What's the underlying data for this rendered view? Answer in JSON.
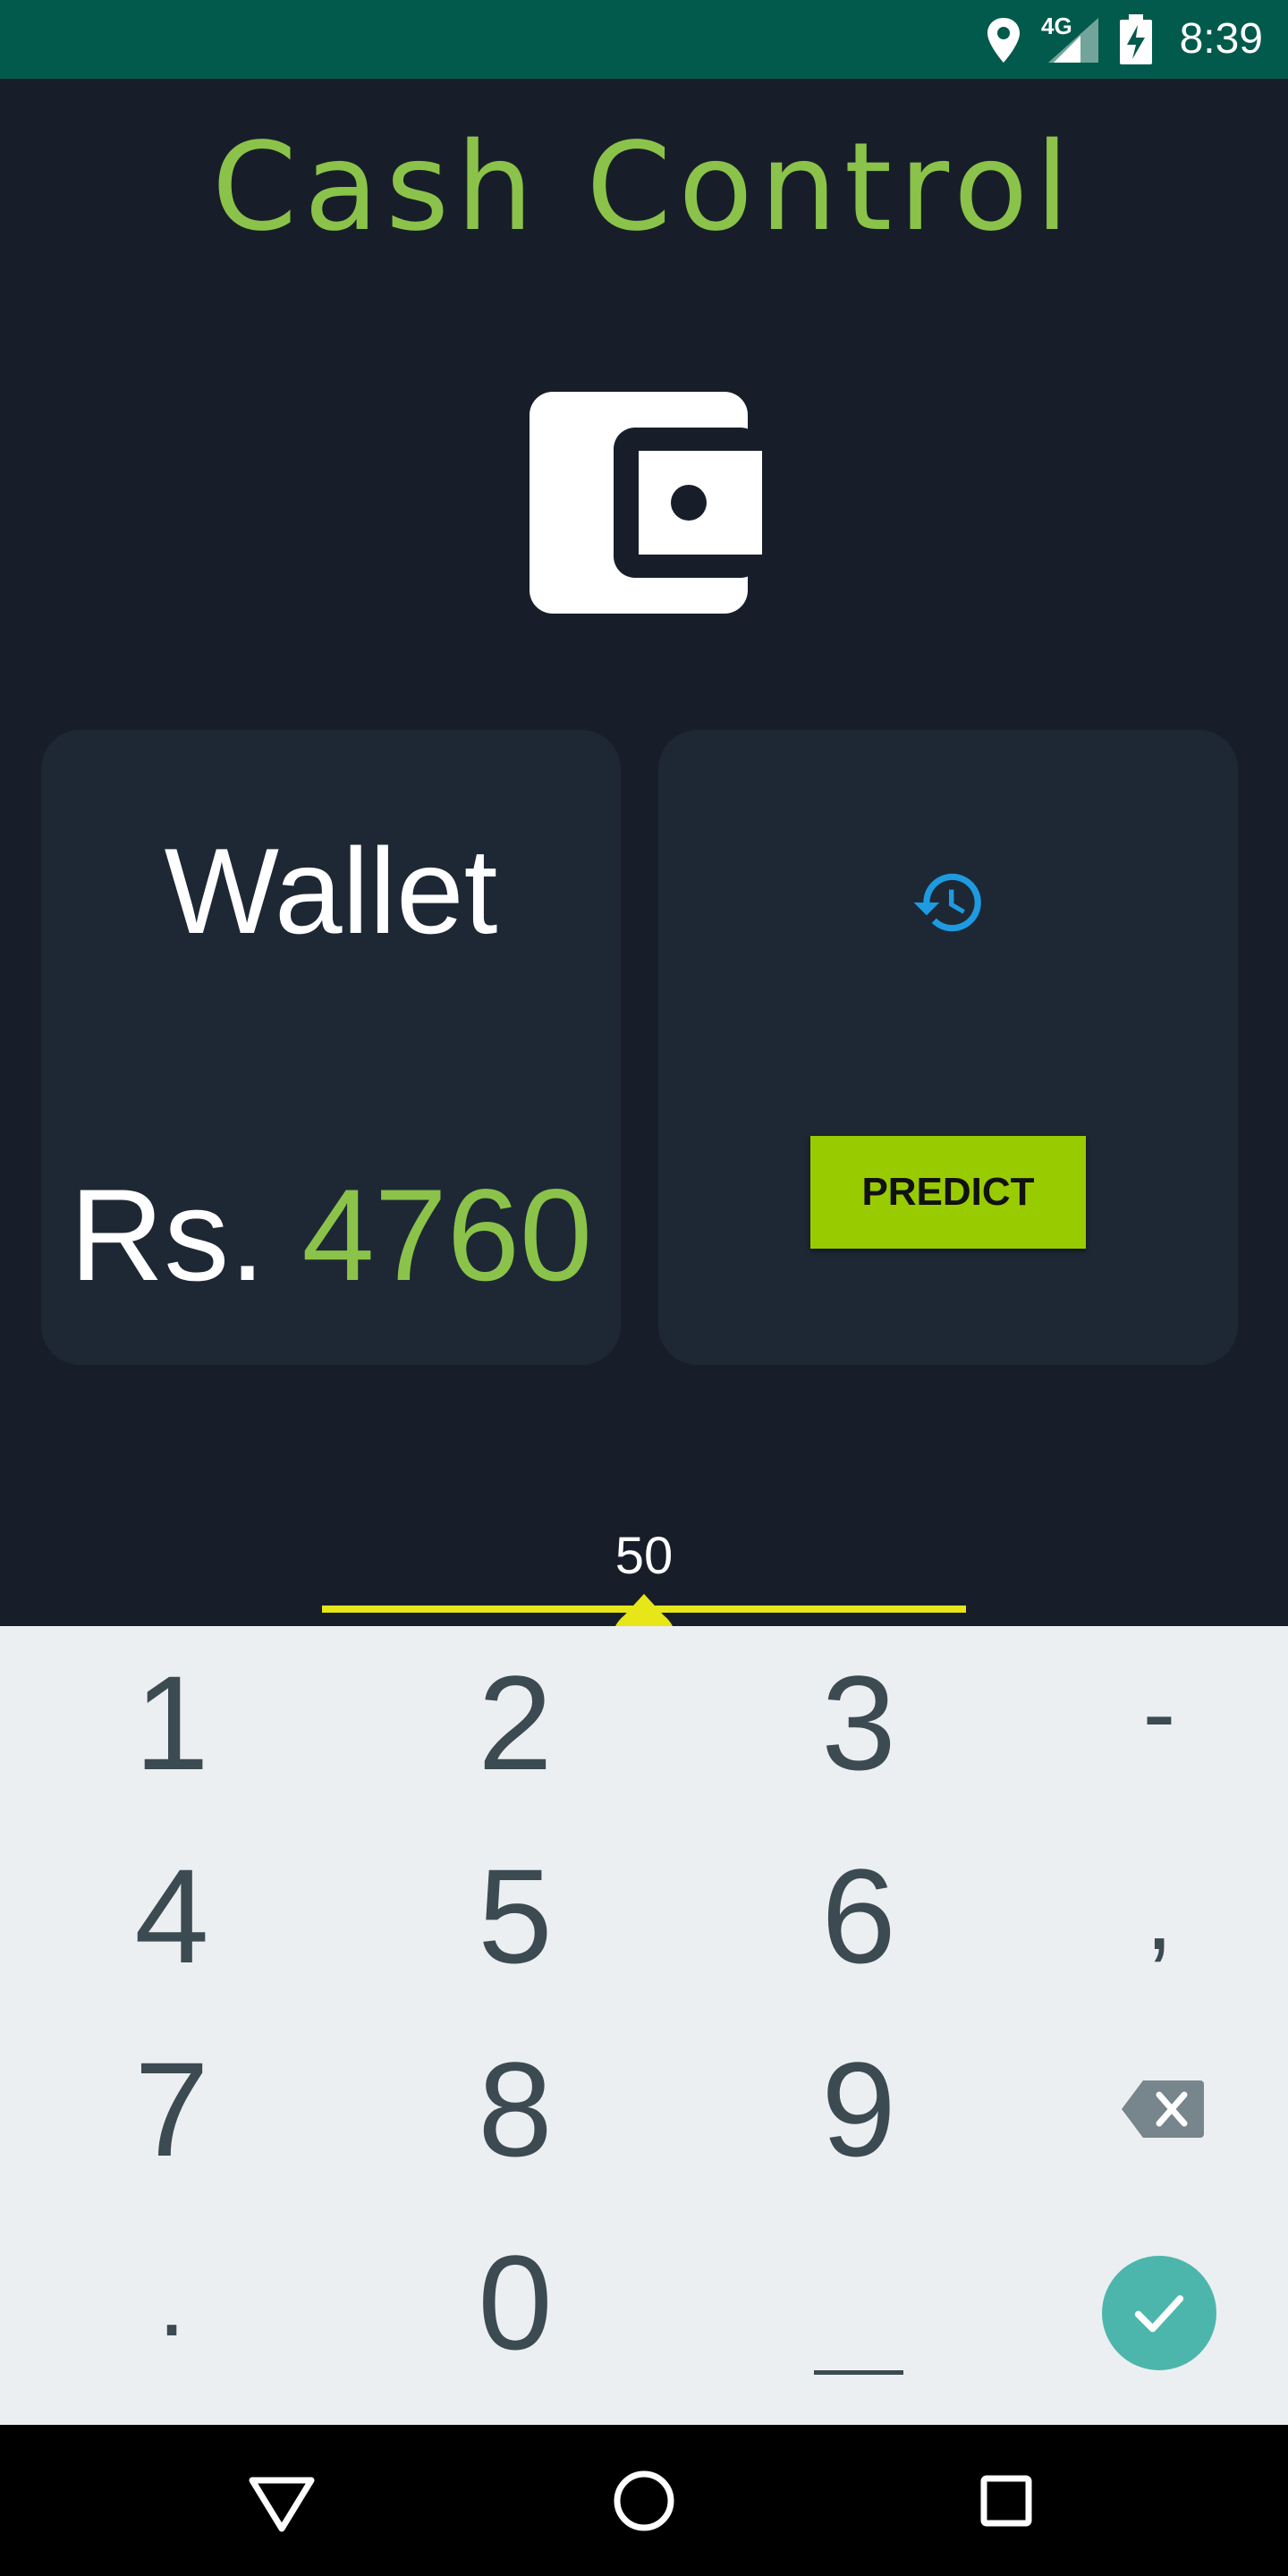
{
  "status_bar": {
    "time": "8:39",
    "network_label": "4G",
    "icons": [
      "location-icon",
      "signal-icon",
      "battery-charging-icon"
    ]
  },
  "app": {
    "title": "Cash Control",
    "title_color": "#8bc34a"
  },
  "wallet_card": {
    "label": "Wallet",
    "currency": "Rs.",
    "amount": "4760"
  },
  "predict_card": {
    "history_icon": "history-icon",
    "button_label": "PREDICT",
    "button_color": "#99cc00"
  },
  "slider": {
    "value": "50",
    "fraction": 0.5,
    "color": "#e6e619"
  },
  "keyboard": {
    "row1": [
      "1",
      "2",
      "3",
      "-"
    ],
    "row2": [
      "4",
      "5",
      "6",
      ","
    ],
    "row3": [
      "7",
      "8",
      "9"
    ],
    "row4_left": ".",
    "row4_mid": "0",
    "backspace_icon": "backspace-icon",
    "space_icon": "space-icon",
    "done_icon": "check-icon",
    "done_color": "#4db6ac"
  },
  "nav_bar": {
    "icons": [
      "back-icon",
      "home-icon",
      "recents-icon"
    ]
  }
}
